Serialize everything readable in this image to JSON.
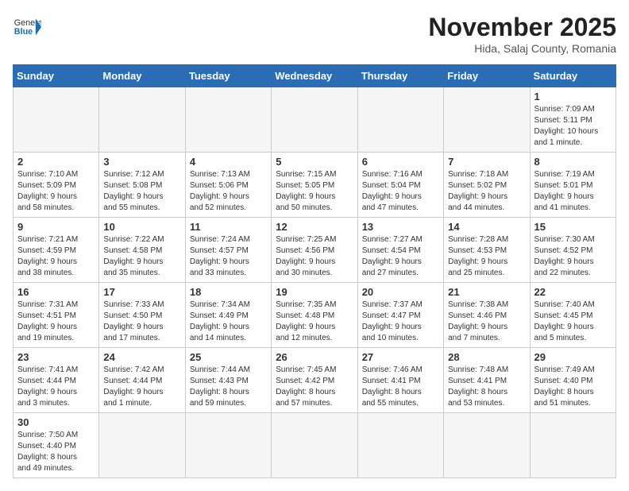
{
  "header": {
    "logo_general": "General",
    "logo_blue": "Blue",
    "month_title": "November 2025",
    "location": "Hida, Salaj County, Romania"
  },
  "weekdays": [
    "Sunday",
    "Monday",
    "Tuesday",
    "Wednesday",
    "Thursday",
    "Friday",
    "Saturday"
  ],
  "weeks": [
    [
      {
        "day": "",
        "info": ""
      },
      {
        "day": "",
        "info": ""
      },
      {
        "day": "",
        "info": ""
      },
      {
        "day": "",
        "info": ""
      },
      {
        "day": "",
        "info": ""
      },
      {
        "day": "",
        "info": ""
      },
      {
        "day": "1",
        "info": "Sunrise: 7:09 AM\nSunset: 5:11 PM\nDaylight: 10 hours\nand 1 minute."
      }
    ],
    [
      {
        "day": "2",
        "info": "Sunrise: 7:10 AM\nSunset: 5:09 PM\nDaylight: 9 hours\nand 58 minutes."
      },
      {
        "day": "3",
        "info": "Sunrise: 7:12 AM\nSunset: 5:08 PM\nDaylight: 9 hours\nand 55 minutes."
      },
      {
        "day": "4",
        "info": "Sunrise: 7:13 AM\nSunset: 5:06 PM\nDaylight: 9 hours\nand 52 minutes."
      },
      {
        "day": "5",
        "info": "Sunrise: 7:15 AM\nSunset: 5:05 PM\nDaylight: 9 hours\nand 50 minutes."
      },
      {
        "day": "6",
        "info": "Sunrise: 7:16 AM\nSunset: 5:04 PM\nDaylight: 9 hours\nand 47 minutes."
      },
      {
        "day": "7",
        "info": "Sunrise: 7:18 AM\nSunset: 5:02 PM\nDaylight: 9 hours\nand 44 minutes."
      },
      {
        "day": "8",
        "info": "Sunrise: 7:19 AM\nSunset: 5:01 PM\nDaylight: 9 hours\nand 41 minutes."
      }
    ],
    [
      {
        "day": "9",
        "info": "Sunrise: 7:21 AM\nSunset: 4:59 PM\nDaylight: 9 hours\nand 38 minutes."
      },
      {
        "day": "10",
        "info": "Sunrise: 7:22 AM\nSunset: 4:58 PM\nDaylight: 9 hours\nand 35 minutes."
      },
      {
        "day": "11",
        "info": "Sunrise: 7:24 AM\nSunset: 4:57 PM\nDaylight: 9 hours\nand 33 minutes."
      },
      {
        "day": "12",
        "info": "Sunrise: 7:25 AM\nSunset: 4:56 PM\nDaylight: 9 hours\nand 30 minutes."
      },
      {
        "day": "13",
        "info": "Sunrise: 7:27 AM\nSunset: 4:54 PM\nDaylight: 9 hours\nand 27 minutes."
      },
      {
        "day": "14",
        "info": "Sunrise: 7:28 AM\nSunset: 4:53 PM\nDaylight: 9 hours\nand 25 minutes."
      },
      {
        "day": "15",
        "info": "Sunrise: 7:30 AM\nSunset: 4:52 PM\nDaylight: 9 hours\nand 22 minutes."
      }
    ],
    [
      {
        "day": "16",
        "info": "Sunrise: 7:31 AM\nSunset: 4:51 PM\nDaylight: 9 hours\nand 19 minutes."
      },
      {
        "day": "17",
        "info": "Sunrise: 7:33 AM\nSunset: 4:50 PM\nDaylight: 9 hours\nand 17 minutes."
      },
      {
        "day": "18",
        "info": "Sunrise: 7:34 AM\nSunset: 4:49 PM\nDaylight: 9 hours\nand 14 minutes."
      },
      {
        "day": "19",
        "info": "Sunrise: 7:35 AM\nSunset: 4:48 PM\nDaylight: 9 hours\nand 12 minutes."
      },
      {
        "day": "20",
        "info": "Sunrise: 7:37 AM\nSunset: 4:47 PM\nDaylight: 9 hours\nand 10 minutes."
      },
      {
        "day": "21",
        "info": "Sunrise: 7:38 AM\nSunset: 4:46 PM\nDaylight: 9 hours\nand 7 minutes."
      },
      {
        "day": "22",
        "info": "Sunrise: 7:40 AM\nSunset: 4:45 PM\nDaylight: 9 hours\nand 5 minutes."
      }
    ],
    [
      {
        "day": "23",
        "info": "Sunrise: 7:41 AM\nSunset: 4:44 PM\nDaylight: 9 hours\nand 3 minutes."
      },
      {
        "day": "24",
        "info": "Sunrise: 7:42 AM\nSunset: 4:44 PM\nDaylight: 9 hours\nand 1 minute."
      },
      {
        "day": "25",
        "info": "Sunrise: 7:44 AM\nSunset: 4:43 PM\nDaylight: 8 hours\nand 59 minutes."
      },
      {
        "day": "26",
        "info": "Sunrise: 7:45 AM\nSunset: 4:42 PM\nDaylight: 8 hours\nand 57 minutes."
      },
      {
        "day": "27",
        "info": "Sunrise: 7:46 AM\nSunset: 4:41 PM\nDaylight: 8 hours\nand 55 minutes."
      },
      {
        "day": "28",
        "info": "Sunrise: 7:48 AM\nSunset: 4:41 PM\nDaylight: 8 hours\nand 53 minutes."
      },
      {
        "day": "29",
        "info": "Sunrise: 7:49 AM\nSunset: 4:40 PM\nDaylight: 8 hours\nand 51 minutes."
      }
    ],
    [
      {
        "day": "30",
        "info": "Sunrise: 7:50 AM\nSunset: 4:40 PM\nDaylight: 8 hours\nand 49 minutes."
      },
      {
        "day": "",
        "info": ""
      },
      {
        "day": "",
        "info": ""
      },
      {
        "day": "",
        "info": ""
      },
      {
        "day": "",
        "info": ""
      },
      {
        "day": "",
        "info": ""
      },
      {
        "day": "",
        "info": ""
      }
    ]
  ]
}
